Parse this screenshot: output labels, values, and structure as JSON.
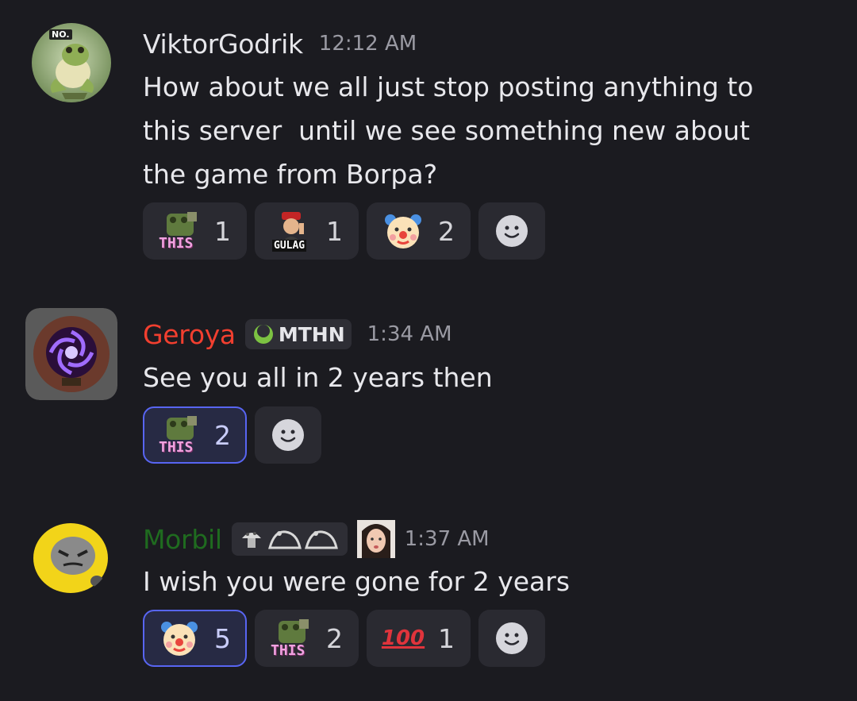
{
  "messages": [
    {
      "author": "ViktorGodrik",
      "author_color": "#e6e6ea",
      "avatar_badge": "NO.",
      "time": "12:12 AM",
      "text": "How about we all just stop posting anything to\nthis server  until we see something new about\nthe game from Borpa?",
      "reactions": [
        {
          "emoji": "this-frog-emoji",
          "label": "THIS",
          "count": "1"
        },
        {
          "emoji": "gulag-emoji",
          "label": "GULAG",
          "count": "1"
        },
        {
          "emoji": "clown-emoji",
          "count": "2"
        }
      ]
    },
    {
      "author": "Geroya",
      "author_color": "#f23f2f",
      "guild_tag": "MTHN",
      "time": "1:34 AM",
      "text": "See you all in 2 years then",
      "reactions": [
        {
          "emoji": "this-frog-emoji",
          "label": "THIS",
          "count": "2",
          "selected": true
        }
      ]
    },
    {
      "author": "Morbil",
      "author_color": "#1f6b1f",
      "time": "1:37 AM",
      "text": "I wish you were gone for 2 years",
      "reactions": [
        {
          "emoji": "clown-emoji",
          "count": "5",
          "selected": true
        },
        {
          "emoji": "this-frog-emoji",
          "label": "THIS",
          "count": "2"
        },
        {
          "emoji": "hundred-emoji",
          "label": "100",
          "count": "1"
        }
      ]
    }
  ],
  "colors": {
    "background": "#1b1b20",
    "reaction_bg": "#2a2a31",
    "reaction_selected_border": "#5865f2",
    "timestamp": "#9a9aa3"
  }
}
